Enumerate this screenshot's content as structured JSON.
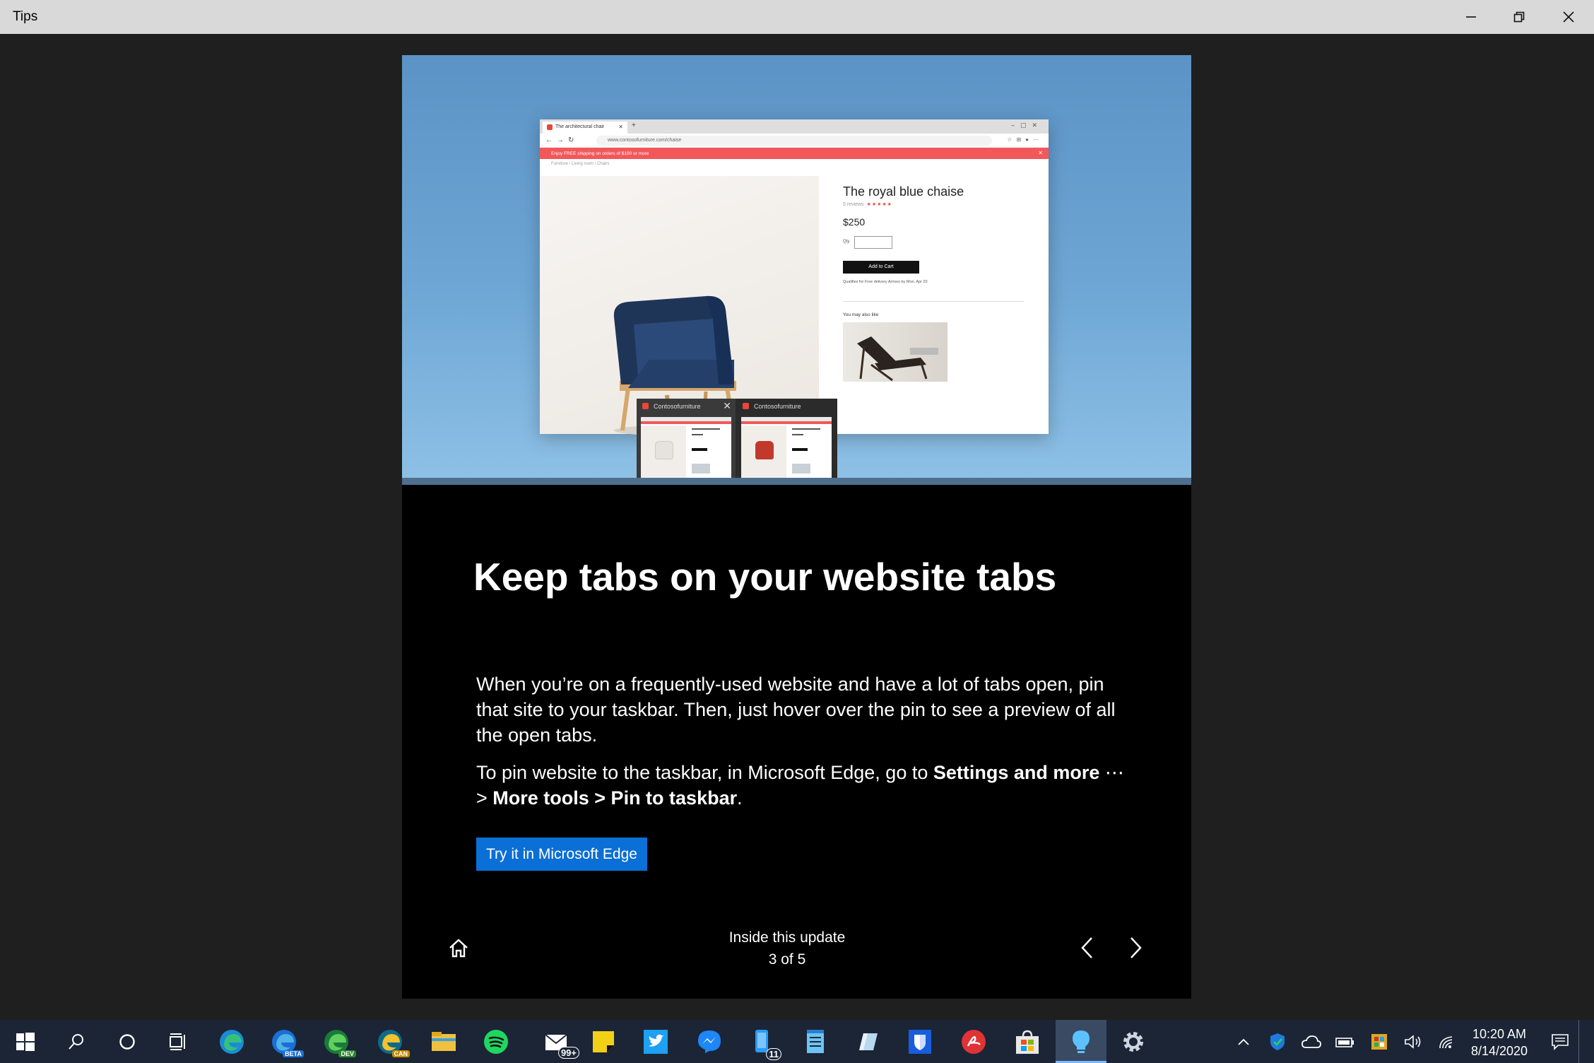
{
  "window": {
    "title": "Tips",
    "controls": [
      "minimize",
      "restore",
      "close"
    ]
  },
  "hero": {
    "browser": {
      "tab_title": "The architectural chair",
      "url": "www.contosofurniture.com/chaise",
      "promo": "Enjoy FREE shipping on orders of $100 or more",
      "breadcrumb": "Furniture  /  Living room  /  Chairs",
      "product_title": "The royal blue chaise",
      "reviews": "5 reviews",
      "stars": "★★★★★",
      "price": "$250",
      "qty_label": "Qty",
      "cart_button": "Add to Cart",
      "delivery": "Qualifies for Free delivery Arrives by Mon, Apr 20",
      "also_like": "You may also like"
    },
    "preview": {
      "tab1": "Contosofurniture",
      "tab2": "Contosofurniture"
    }
  },
  "content": {
    "headline": "Keep tabs on your website tabs",
    "paragraph1": "When you’re on a frequently-used website and have a lot of tabs open, pin that site to your taskbar. Then, just hover over the pin to see a preview of all the open tabs.",
    "p2_prefix": "To pin website to the taskbar, in Microsoft Edge, go to ",
    "p2_bold1": "Settings and more",
    "p2_ellipsis": " ⋯ > ",
    "p2_bold2": "More tools > Pin to taskbar",
    "p2_suffix": ".",
    "button": "Try it in Microsoft Edge"
  },
  "footer": {
    "section": "Inside this update",
    "page": "3 of 5"
  },
  "taskbar": {
    "badges": {
      "edge_beta": "BETA",
      "edge_dev": "DEV",
      "edge_can": "CAN",
      "mail_count": "99+",
      "phone_count": "11"
    },
    "clock_time": "10:20 AM",
    "clock_date": "8/14/2020"
  },
  "colors": {
    "accent": "#0a6fd6",
    "taskbar": "#1b2536",
    "titlebar": "#d9d9d9",
    "promo": "#f2585a"
  }
}
